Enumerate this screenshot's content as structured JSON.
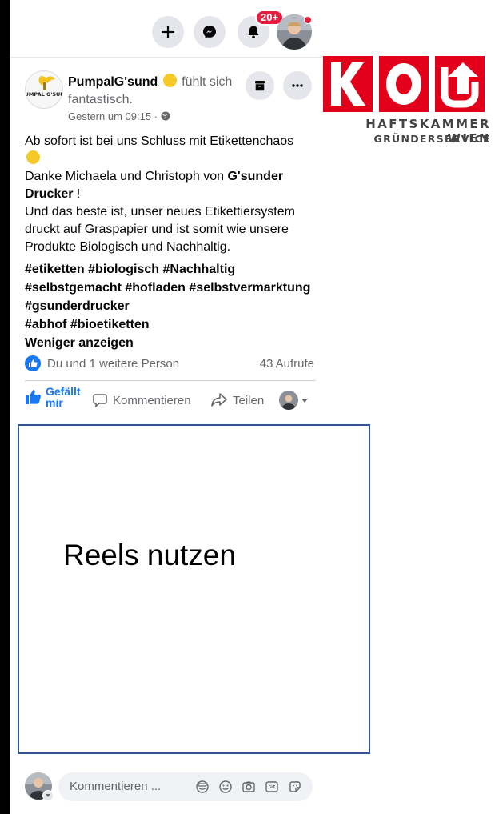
{
  "topbar": {
    "notification_badge": "20+"
  },
  "logo": {
    "letters": "KO",
    "line1": "HAFTSKAMMER WIEN",
    "line2": "GRÜNDERSERVICE",
    "brand_color": "#e2001a"
  },
  "post": {
    "page_name": "PumpalG'sund",
    "feeling_text": "fühlt sich fantastisch.",
    "avatar_text": "PUMPAL G'SUND",
    "timestamp": "Gestern um 09:15 ·",
    "body_line1": "Ab sofort ist bei uns Schluss mit Etikettenchaos",
    "body_line2_pre": "Danke Michaela und Christoph von ",
    "body_line2_bold": "G'sunder Drucker",
    "body_line2_post": " !",
    "body_line3": "Und das beste ist, unser neues Etikettiersystem druckt auf Graspapier und ist somit wie unsere Produkte Biologisch und Nachhaltig.",
    "hashtags_line1": "#etiketten #biologisch #Nachhaltig",
    "hashtags_line2": "#selbstgemacht #hofladen #selbstvermarktung",
    "hashtags_line3": "#gsunderdrucker",
    "hashtags_line4": "#abhof #bioetiketten",
    "less_link": "Weniger anzeigen",
    "reactions_text": "Du und 1 weitere Person",
    "views_text": "43 Aufrufe",
    "like_label": "Gefällt mir",
    "comment_label": "Kommentieren",
    "share_label": "Teilen",
    "accent_color": "#1877f2"
  },
  "overlay": {
    "reels_text": "Reels nutzen",
    "border_color": "#2f5597"
  },
  "comment_box": {
    "placeholder": "Kommentieren ..."
  }
}
